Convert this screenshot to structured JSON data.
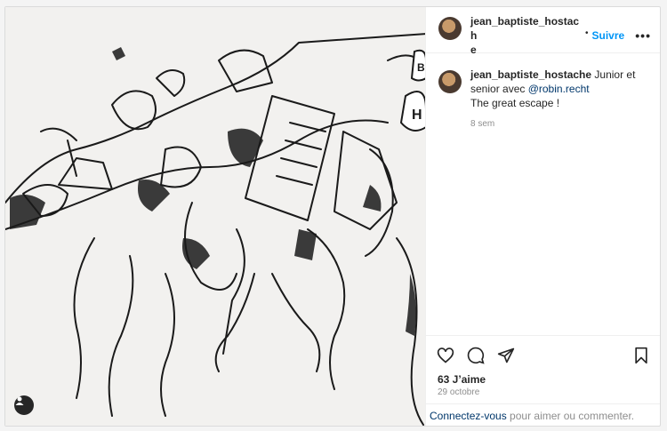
{
  "post": {
    "username_line1": "jean_baptiste_hostach",
    "username_line2": "e",
    "dot": "•",
    "follow_label": "Suivre",
    "more_label": "•••",
    "caption_user": "jean_baptiste_hostache",
    "caption_text_1": " Junior et senior avec ",
    "caption_mention": "@robin.recht",
    "caption_text_2": "The great escape !",
    "caption_age": "8 sem",
    "likes": "63 J’aime",
    "date": "29 octobre",
    "login_link": "Connectez-vous",
    "login_rest": " pour aimer ou commenter."
  },
  "image": {
    "speech_letters": [
      "B",
      "H"
    ],
    "ink_color": "#1a1a1a",
    "paper_color": "#f2f1ef"
  },
  "icons": [
    "heart-icon",
    "comment-icon",
    "share-icon",
    "bookmark-icon",
    "more-icon",
    "user-tag-icon"
  ]
}
